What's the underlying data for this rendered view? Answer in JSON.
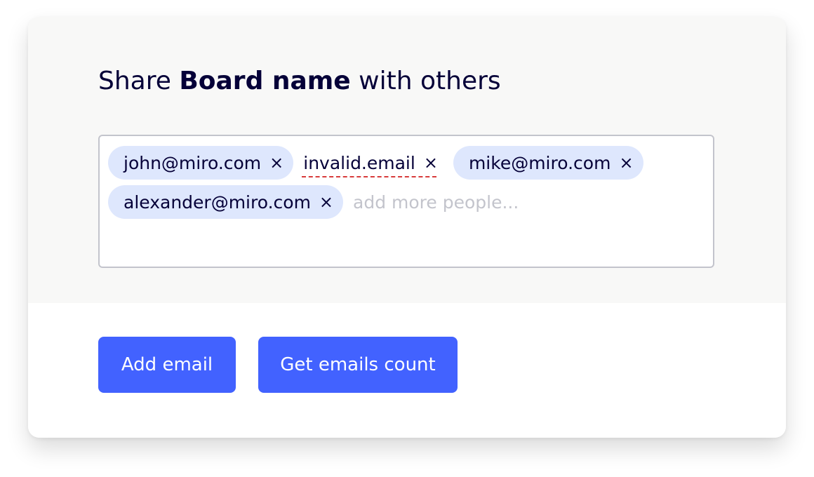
{
  "share": {
    "title_prefix": "Share",
    "board_name": "Board name",
    "title_suffix": "with others"
  },
  "emails": [
    {
      "email": "john@miro.com",
      "valid": true
    },
    {
      "email": "invalid.email",
      "valid": false
    },
    {
      "email": "mike@miro.com",
      "valid": true
    },
    {
      "email": "alexander@miro.com",
      "valid": true
    }
  ],
  "remove_glyph": "×",
  "input": {
    "placeholder": "add more people..."
  },
  "buttons": {
    "add_email": "Add email",
    "get_count": "Get emails count"
  },
  "colors": {
    "primary": "#4262ff",
    "chip_background": "#dee7fd",
    "invalid_underline": "#d83b3b",
    "text": "#050038",
    "placeholder": "#c3c4cc",
    "panel_background": "#f8f8f7"
  }
}
